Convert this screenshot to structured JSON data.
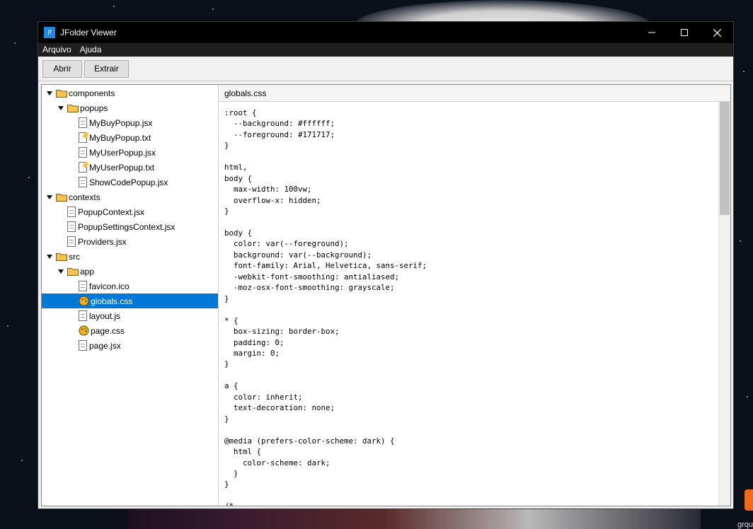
{
  "window": {
    "title": "JFolder Viewer",
    "icon_label": "jf"
  },
  "menu": {
    "items": [
      "Arquivo",
      "Ajuda"
    ]
  },
  "toolbar": {
    "open_label": "Abrir",
    "extract_label": "Extrair"
  },
  "tree": {
    "items": [
      {
        "label": "components",
        "type": "folder",
        "depth": 0,
        "expanded": true
      },
      {
        "label": "popups",
        "type": "folder",
        "depth": 1,
        "expanded": true
      },
      {
        "label": "MyBuyPopup.jsx",
        "type": "file",
        "depth": 2
      },
      {
        "label": "MyBuyPopup.txt",
        "type": "txt",
        "depth": 2
      },
      {
        "label": "MyUserPopup.jsx",
        "type": "file",
        "depth": 2
      },
      {
        "label": "MyUserPopup.txt",
        "type": "txt",
        "depth": 2
      },
      {
        "label": "ShowCodePopup.jsx",
        "type": "file",
        "depth": 2
      },
      {
        "label": "contexts",
        "type": "folder",
        "depth": 0,
        "expanded": true
      },
      {
        "label": "PopupContext.jsx",
        "type": "file",
        "depth": 1
      },
      {
        "label": "PopupSettingsContext.jsx",
        "type": "file",
        "depth": 1
      },
      {
        "label": "Providers.jsx",
        "type": "file",
        "depth": 1
      },
      {
        "label": "src",
        "type": "folder",
        "depth": 0,
        "expanded": true
      },
      {
        "label": "app",
        "type": "folder",
        "depth": 1,
        "expanded": true
      },
      {
        "label": "favicon.ico",
        "type": "file",
        "depth": 2
      },
      {
        "label": "globals.css",
        "type": "css",
        "depth": 2,
        "selected": true
      },
      {
        "label": "layout.js",
        "type": "file",
        "depth": 2
      },
      {
        "label": "page.css",
        "type": "css",
        "depth": 2
      },
      {
        "label": "page.jsx",
        "type": "file",
        "depth": 2
      }
    ]
  },
  "editor": {
    "filename": "globals.css",
    "code": ":root {\n  --background: #ffffff;\n  --foreground: #171717;\n}\n\nhtml,\nbody {\n  max-width: 100vw;\n  overflow-x: hidden;\n}\n\nbody {\n  color: var(--foreground);\n  background: var(--background);\n  font-family: Arial, Helvetica, sans-serif;\n  -webkit-font-smoothing: antialiased;\n  -moz-osx-font-smoothing: grayscale;\n}\n\n* {\n  box-sizing: border-box;\n  padding: 0;\n  margin: 0;\n}\n\na {\n  color: inherit;\n  text-decoration: none;\n}\n\n@media (prefers-color-scheme: dark) {\n  html {\n    color-scheme: dark;\n  }\n}\n\n/*"
  },
  "desktop": {
    "corner_text": "grqu"
  },
  "colors": {
    "selection": "#0078d7",
    "titlebar": "#000000",
    "menubar": "#1f1f1f",
    "folder": "#f5c451",
    "css_icon": "#f3b316"
  }
}
